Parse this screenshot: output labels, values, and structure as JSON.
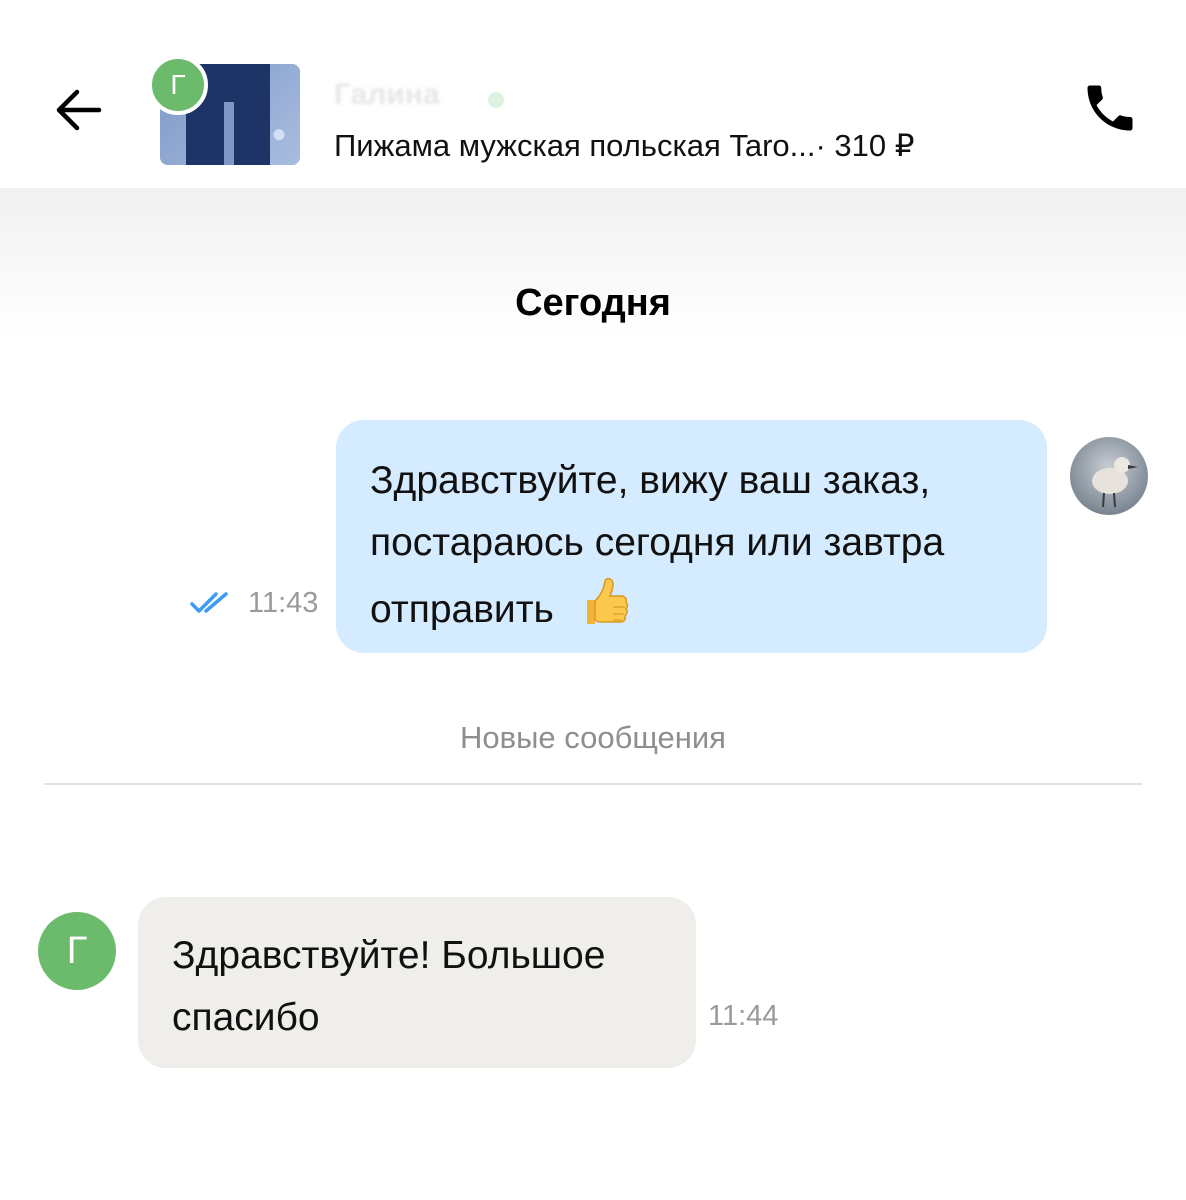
{
  "header": {
    "seller_name": "Галина",
    "seller_initial": "Г",
    "item_title": "Пижама мужская польская Taro...",
    "price": "· 310 ₽"
  },
  "chat": {
    "date_separator": "Сегодня",
    "new_messages_label": "Новые сообщения",
    "messages": [
      {
        "direction": "outgoing",
        "text": "Здравствуйте, вижу ваш заказ, постараюсь сегодня или завтра отправить",
        "emoji": "👍",
        "time": "11:43",
        "status": "read"
      },
      {
        "direction": "incoming",
        "text": "Здравствуйте! Большое спасибо",
        "time": "11:44",
        "sender_initial": "Г"
      }
    ]
  },
  "colors": {
    "outgoing_bubble": "#d5ebff",
    "incoming_bubble": "#efeeea",
    "avatar_green": "#6cbb6d",
    "read_check": "#3d9bf5"
  }
}
